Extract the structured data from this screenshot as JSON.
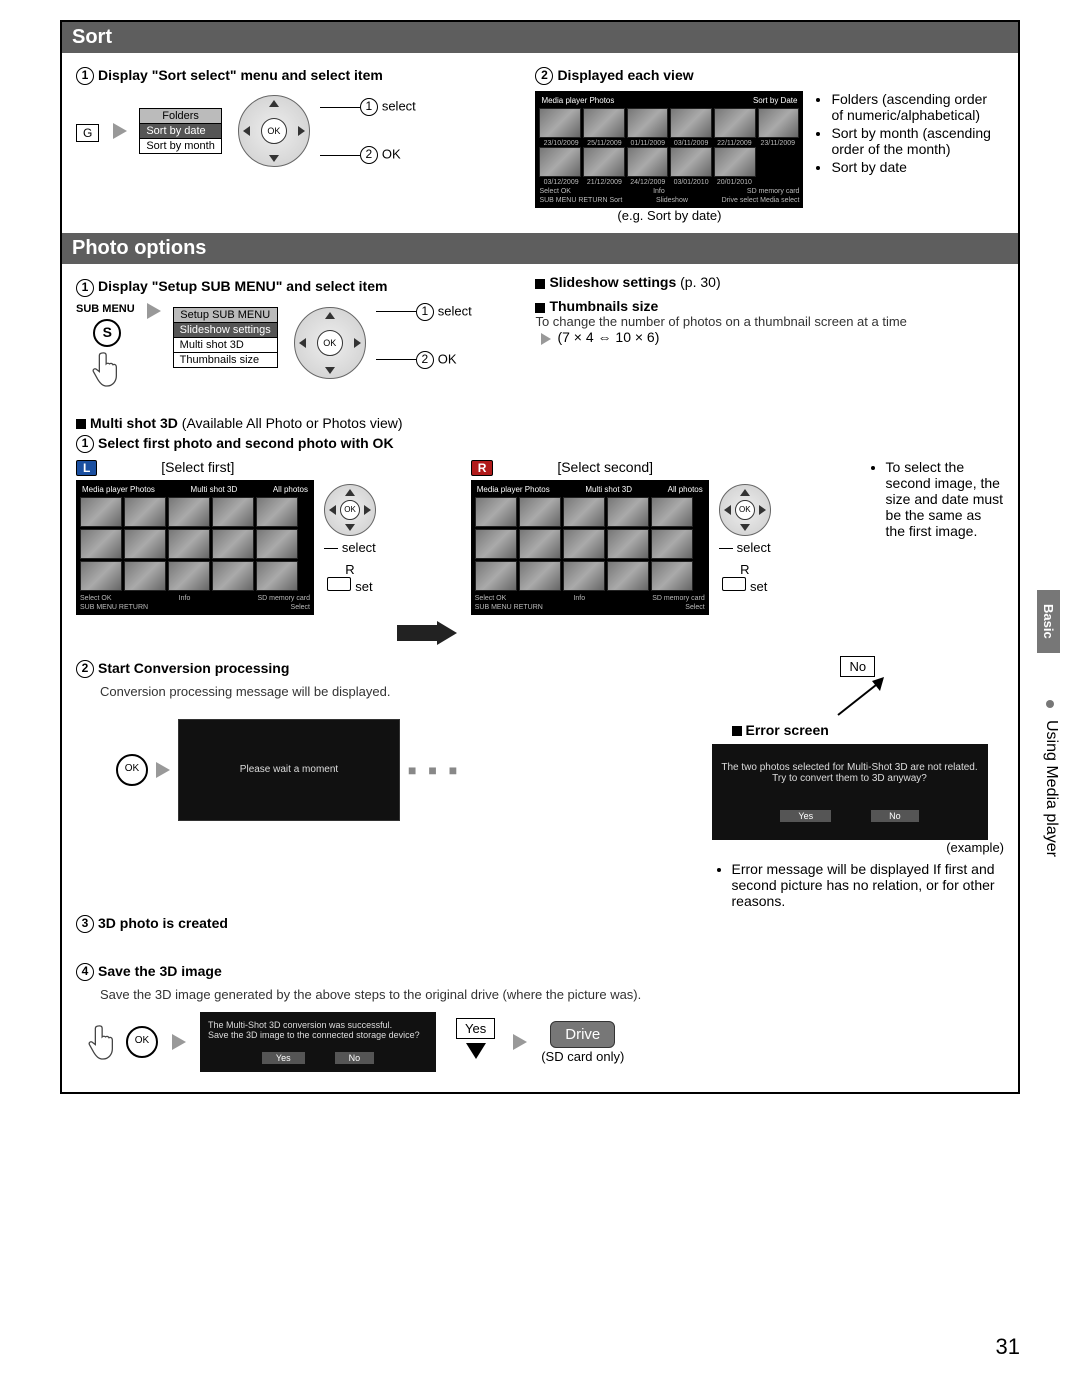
{
  "sideTab": "Basic",
  "sideLabel": "Using Media player",
  "pageNumber": "31",
  "sort": {
    "header": "Sort",
    "step1": "Display \"Sort select\" menu and select item",
    "step2": "Displayed each view",
    "gLabel": "G",
    "menuTitle": "Folders",
    "menuItems": [
      "Sort by date",
      "Sort by month"
    ],
    "selectLabel": "select",
    "okLabel": "OK",
    "eg": "(e.g. Sort by date)",
    "bullets": [
      "Folders (ascending order of numeric/alphabetical)",
      "Sort by month (ascending order of the month)",
      "Sort by date"
    ],
    "gridHeaderLeft": "Media player  Photos",
    "gridHeaderRight": "Sort by Date",
    "dates": [
      "23/10/2009",
      "25/11/2009",
      "01/11/2009",
      "03/11/2009",
      "22/11/2009",
      "23/11/2009"
    ],
    "dates2": [
      "03/12/2009",
      "21/12/2009",
      "24/12/2009",
      "03/01/2010",
      "20/01/2010"
    ],
    "footer": [
      "Select  OK",
      "Info",
      "SD memory card",
      "SUB MENU  RETURN  Sort",
      "Slideshow",
      "Drive select  Media select"
    ]
  },
  "photo": {
    "header": "Photo options",
    "step1": "Display \"Setup SUB MENU\" and select item",
    "subMenuLabel": "SUB MENU",
    "sKey": "S",
    "menuTitle": "Setup SUB MENU",
    "menuItems": [
      "Slideshow settings",
      "Multi shot 3D",
      "Thumbnails size"
    ],
    "selectLabel": "select",
    "okLabel": "OK",
    "slideshowHeading": "Slideshow settings",
    "slideshowPage": "(p. 30)",
    "thumbHeading": "Thumbnails size",
    "thumbDesc": "To change the number of photos on a thumbnail screen at a time",
    "thumbSpec": "(7 × 4 ⇔ 10 × 6)"
  },
  "multi": {
    "heading": "Multi shot 3D",
    "availability": "(Available All Photo or Photos view)",
    "step1": "Select first photo and second photo with OK",
    "selectFirst": "[Select first]",
    "selectSecond": "[Select second]",
    "select": "select",
    "set": "set",
    "rLabel": "R",
    "note": "To select the second image, the size and date must be the same as the first image.",
    "step2": "Start Conversion processing",
    "step2desc": "Conversion processing message will be displayed.",
    "waitMsg": "Please wait a moment",
    "noLabel": "No",
    "errorHeading": "Error screen",
    "errorLine1": "The two photos selected for Multi-Shot 3D are not related.",
    "errorLine2": "Try to convert them to 3D anyway?",
    "yes": "Yes",
    "no": "No",
    "example": "(example)",
    "errorDesc": "Error message will be displayed If first and second picture has no relation, or for other reasons.",
    "step3": "3D photo is created",
    "step4": "Save the 3D image",
    "step4desc": "Save the 3D image generated by the above steps to the original drive (where the picture was).",
    "saveLine1": "The Multi-Shot 3D conversion was successful.",
    "saveLine2": "Save the 3D image to the connected storage device?",
    "yesBox": "Yes",
    "driveBtn": "Drive",
    "driveNote": "(SD card only)",
    "gridHeaderLeft": "Media player  Photos",
    "gridHeaderMid": "Multi shot 3D",
    "gridHeaderRight": "All photos"
  }
}
